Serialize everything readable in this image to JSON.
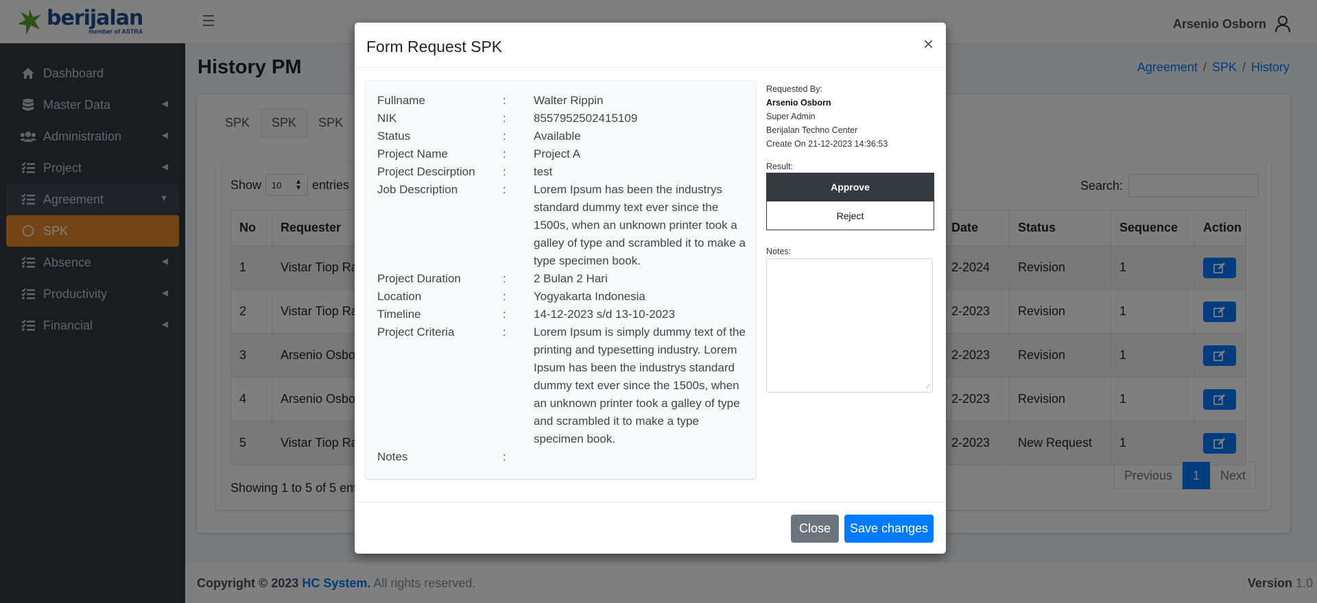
{
  "brand": {
    "name": "berijalan",
    "sub": "member of ASTRA",
    "color": "#1c4f8c",
    "accent": "#5aa02c"
  },
  "sidebar": {
    "items": [
      {
        "label": "Dashboard",
        "icon": "home-icon"
      },
      {
        "label": "Master Data",
        "icon": "database-icon"
      },
      {
        "label": "Administration",
        "icon": "users-icon"
      },
      {
        "label": "Project",
        "icon": "list-icon"
      },
      {
        "label": "Agreement",
        "icon": "list-icon"
      },
      {
        "label": "SPK",
        "icon": "circle-icon"
      },
      {
        "label": "Absence",
        "icon": "list-icon"
      },
      {
        "label": "Productivity",
        "icon": "list-icon"
      },
      {
        "label": "Financial",
        "icon": "list-icon"
      }
    ],
    "active_color": "#e8882a"
  },
  "header": {
    "user_name": "Arsenio Osborn"
  },
  "page": {
    "title": "History PM",
    "breadcrumb": [
      "Agreement",
      "SPK",
      "History"
    ]
  },
  "tabs": [
    "SPK",
    "SPK",
    "SPK"
  ],
  "list": {
    "show_label": "Show",
    "show_value": "10",
    "entries_label": "entries",
    "search_label": "Search:",
    "columns": [
      "No",
      "Requester",
      "Date",
      "Status",
      "Sequence",
      "Action"
    ],
    "rows": [
      {
        "no": "1",
        "requester": "Vistar Tiop Ra",
        "date": "2-2024",
        "status": "Revision",
        "sequence": "1"
      },
      {
        "no": "2",
        "requester": "Vistar Tiop Ra",
        "date": "2-2023",
        "status": "Revision",
        "sequence": "1"
      },
      {
        "no": "3",
        "requester": "Arsenio Osbor",
        "date": "2-2023",
        "status": "Revision",
        "sequence": "1"
      },
      {
        "no": "4",
        "requester": "Arsenio Osbor",
        "date": "2-2023",
        "status": "Revision",
        "sequence": "1"
      },
      {
        "no": "5",
        "requester": "Vistar Tiop Ra",
        "date": "2-2023",
        "status": "New Request",
        "sequence": "1"
      }
    ],
    "showing": "Showing 1 to 5 of 5 ent",
    "pager": {
      "previous": "Previous",
      "current": "1",
      "next": "Next"
    }
  },
  "footer": {
    "copyright": "Copyright © 2023",
    "company": "HC System.",
    "rights": "All rights reserved.",
    "version_label": "Version",
    "version": "1.0"
  },
  "modal": {
    "title": "Form Request SPK",
    "close_icon": "×",
    "fields": [
      {
        "key": "Fullname",
        "value": "Walter Rippin"
      },
      {
        "key": "NIK",
        "value": "8557952502415109"
      },
      {
        "key": "Status",
        "value": "Available"
      },
      {
        "key": "Project Name",
        "value": "Project A"
      },
      {
        "key": "Project Descirption",
        "value": "test"
      },
      {
        "key": "Job Description",
        "value": "Lorem Ipsum has been the industrys standard dummy text ever since the 1500s, when an unknown printer took a galley of type and scrambled it to make a type specimen book."
      },
      {
        "key": "Project Duration",
        "value": "2 Bulan 2 Hari"
      },
      {
        "key": "Location",
        "value": "Yogyakarta Indonesia"
      },
      {
        "key": "Timeline",
        "value": "14-12-2023 s/d 13-10-2023"
      },
      {
        "key": "Project Criteria",
        "value": "Lorem Ipsum is simply dummy text of the printing and typesetting industry. Lorem Ipsum has been the industrys standard dummy text ever since the 1500s, when an unknown printer took a galley of type and scrambled it to make a type specimen book."
      },
      {
        "key": "Notes",
        "value": ""
      }
    ],
    "separator": ":",
    "requested_by_label": "Requested By:",
    "requester_name": "Arsenio Osborn",
    "requester_role": "Super Admin",
    "requester_org": "Berijalan Techno Center",
    "created_on": "Create On 21-12-2023 14:36:53",
    "result_label": "Result:",
    "approve_label": "Approve",
    "reject_label": "Reject",
    "notes_label": "Notes:",
    "notes_value": "",
    "close_button": "Close",
    "save_button": "Save changes"
  }
}
